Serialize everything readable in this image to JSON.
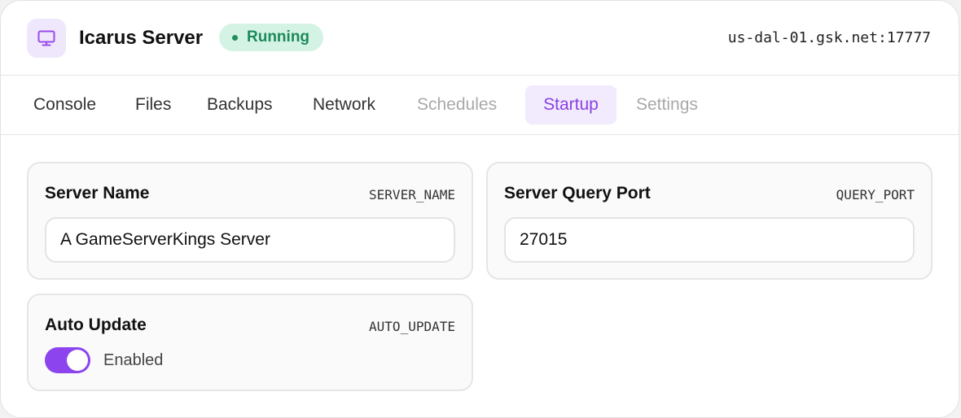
{
  "header": {
    "title": "Icarus Server",
    "status": "Running",
    "address": "us-dal-01.gsk.net:17777",
    "icon": "monitor-icon"
  },
  "tabs": [
    {
      "label": "Console",
      "state": "normal"
    },
    {
      "label": "Files",
      "state": "normal"
    },
    {
      "label": "Backups",
      "state": "normal"
    },
    {
      "label": "Network",
      "state": "normal"
    },
    {
      "label": "Schedules",
      "state": "disabled"
    },
    {
      "label": "Startup",
      "state": "active"
    },
    {
      "label": "Settings",
      "state": "disabled"
    }
  ],
  "variables": {
    "server_name": {
      "label": "Server Name",
      "key": "SERVER_NAME",
      "value": "A GameServerKings Server"
    },
    "query_port": {
      "label": "Server Query Port",
      "key": "QUERY_PORT",
      "value": "27015"
    },
    "auto_update": {
      "label": "Auto Update",
      "key": "AUTO_UPDATE",
      "state_label": "Enabled",
      "enabled": true
    }
  },
  "colors": {
    "accent": "#8b44ee",
    "status_bg": "#d5f3e5",
    "status_text": "#1c8a5a"
  }
}
